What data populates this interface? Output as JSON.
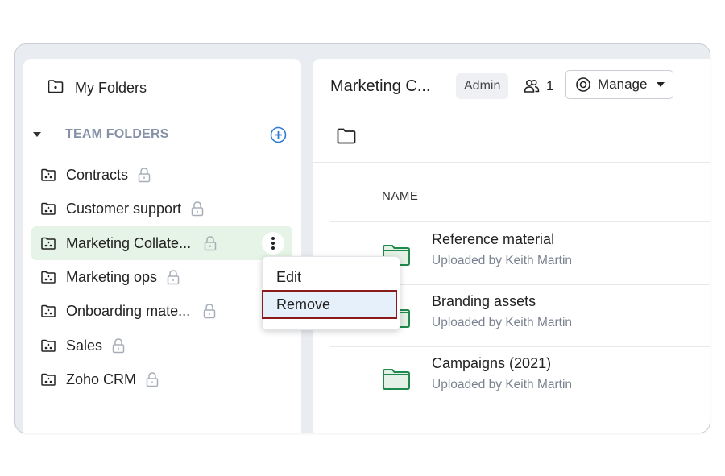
{
  "sidebar": {
    "my_folders_label": "My Folders",
    "team_folders_label": "TEAM FOLDERS",
    "folders": [
      {
        "label": "Contracts"
      },
      {
        "label": "Customer support"
      },
      {
        "label": "Marketing Collate..."
      },
      {
        "label": "Marketing ops"
      },
      {
        "label": "Onboarding mate..."
      },
      {
        "label": "Sales"
      },
      {
        "label": "Zoho CRM"
      }
    ],
    "active_index": 2
  },
  "context_menu": {
    "items": [
      {
        "label": "Edit"
      },
      {
        "label": "Remove"
      }
    ]
  },
  "main": {
    "title": "Marketing C...",
    "role_badge": "Admin",
    "member_count": "1",
    "manage_label": "Manage",
    "column_name": "NAME",
    "files": [
      {
        "name": "Reference material",
        "meta": "Uploaded by Keith Martin"
      },
      {
        "name": "Branding assets",
        "meta": "Uploaded by Keith Martin"
      },
      {
        "name": "Campaigns (2021)",
        "meta": "Uploaded by Keith Martin"
      }
    ]
  },
  "colors": {
    "active_item_bg": "#e5f4e6",
    "accent_blue": "#2f7bd8",
    "folder_green": "#1f8a4c",
    "folder_fill": "#e4f1e6",
    "highlight_border": "#8b1a1a"
  },
  "icons": {
    "my_folders": "folder-dot-icon",
    "team_folder": "team-folder-icon",
    "lock": "lock-icon",
    "add": "plus-circle-icon",
    "members": "users-icon",
    "manage": "gear-icon",
    "folder_outline": "folder-icon",
    "file_folder": "folder-filled-icon",
    "more": "kebab-icon"
  }
}
